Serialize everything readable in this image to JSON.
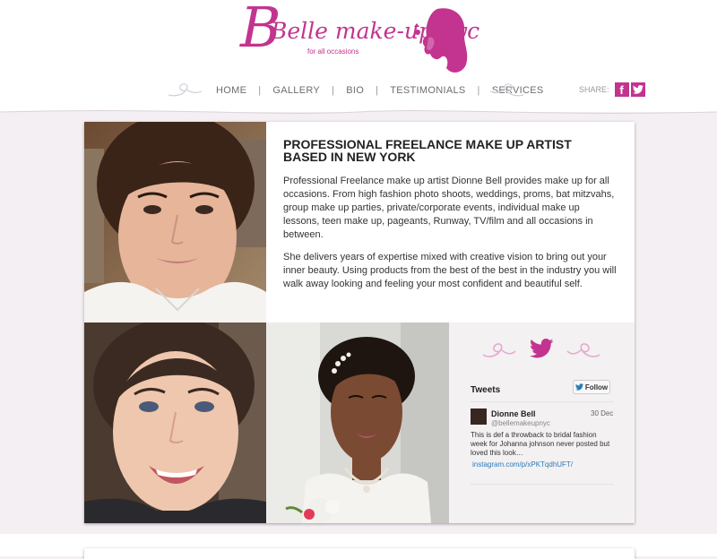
{
  "brand": {
    "name": "Belle make-up nyc",
    "tagline": "for all occasions",
    "accent_color": "#c2348f"
  },
  "nav": {
    "items": [
      "HOME",
      "GALLERY",
      "BIO",
      "TESTIMONIALS",
      "SERVICES"
    ],
    "separator": "|"
  },
  "share": {
    "label": "SHARE:",
    "icons": [
      {
        "name": "facebook-icon",
        "glyph": "f"
      },
      {
        "name": "twitter-icon",
        "glyph": "t"
      }
    ]
  },
  "main": {
    "headline": "PROFESSIONAL FREELANCE MAKE UP ARTIST BASED IN NEW YORK",
    "paragraphs": [
      "Professional Freelance make up artist Dionne Bell provides make up for all occasions. From high fashion photo shoots, weddings, proms, bat mitzvahs, group make up parties, private/corporate events, individual make up lessons, teen make up, pageants, Runway, TV/film and all occasions in between.",
      "She delivers years of expertise mixed with creative vision to bring out your inner beauty. Using products from the best of the best in the industry you will walk away looking and feeling your most confident and beautiful self."
    ]
  },
  "twitter": {
    "title": "Tweets",
    "follow_label": "Follow",
    "tweet": {
      "name": "Dionne Bell",
      "handle": "@bellemakeupnyc",
      "date": "30 Dec",
      "text": "This is def a throwback to bridal fashion week for Johanna johnson never posted but loved this look…",
      "link": "instagram.com/p/xPKTqdhUFT/"
    }
  }
}
